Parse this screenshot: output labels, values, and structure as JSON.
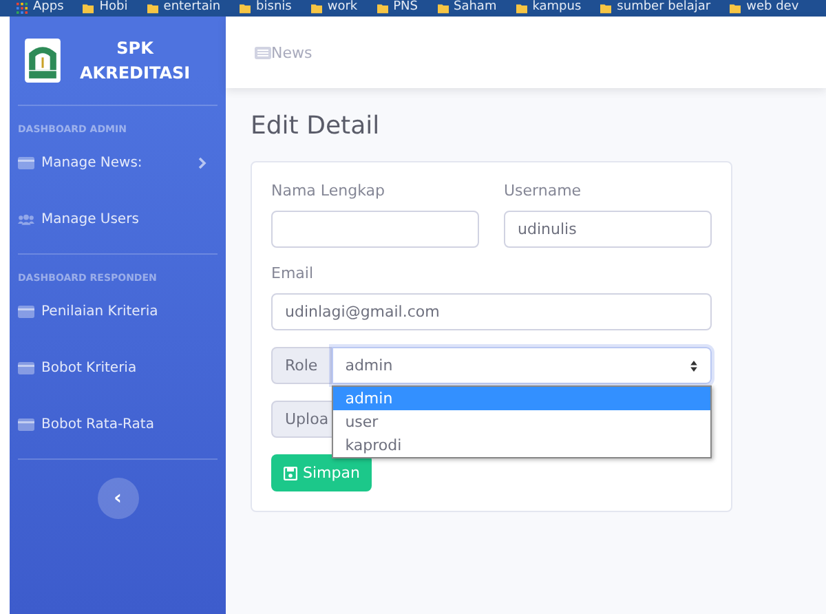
{
  "bookmarks": [
    {
      "label": "Apps",
      "kind": "apps"
    },
    {
      "label": "Hobi",
      "kind": "folder"
    },
    {
      "label": "entertain",
      "kind": "folder"
    },
    {
      "label": "bisnis",
      "kind": "folder"
    },
    {
      "label": "work",
      "kind": "folder"
    },
    {
      "label": "PNS",
      "kind": "folder"
    },
    {
      "label": "Saham",
      "kind": "folder"
    },
    {
      "label": "kampus",
      "kind": "folder"
    },
    {
      "label": "sumber belajar",
      "kind": "folder"
    },
    {
      "label": "web dev",
      "kind": "folder"
    }
  ],
  "brand": {
    "title": "SPK AKREDITASI"
  },
  "sidebar": {
    "sections": [
      {
        "heading": "DASHBOARD ADMIN",
        "items": [
          {
            "label": "Manage News:",
            "kind": "card",
            "has_arrow": true
          },
          {
            "label": "Manage Users",
            "kind": "users",
            "has_arrow": false
          }
        ]
      },
      {
        "heading": "DASHBOARD RESPONDEN",
        "items": [
          {
            "label": "Penilaian Kriteria",
            "kind": "card",
            "has_arrow": false
          },
          {
            "label": "Bobot Kriteria",
            "kind": "card",
            "has_arrow": false
          },
          {
            "label": "Bobot Rata-Rata",
            "kind": "card",
            "has_arrow": false
          }
        ]
      }
    ],
    "toggle": "‹"
  },
  "topbar": {
    "breadcrumb": "News"
  },
  "page": {
    "title": "Edit Detail"
  },
  "form": {
    "name": {
      "label": "Nama Lengkap"
    },
    "username": {
      "label": "Username",
      "value": "udinulis"
    },
    "email": {
      "label": "Email",
      "value": "udinlagi@gmail.com"
    },
    "role": {
      "label": "Role",
      "value": "admin",
      "expanded": true,
      "options": [
        {
          "label": "admin",
          "selected": true
        },
        {
          "label": "user",
          "selected": false
        },
        {
          "label": "kaprodi",
          "selected": false
        }
      ]
    },
    "upload": {
      "label": "Uploa"
    },
    "submit": "Simpan"
  }
}
